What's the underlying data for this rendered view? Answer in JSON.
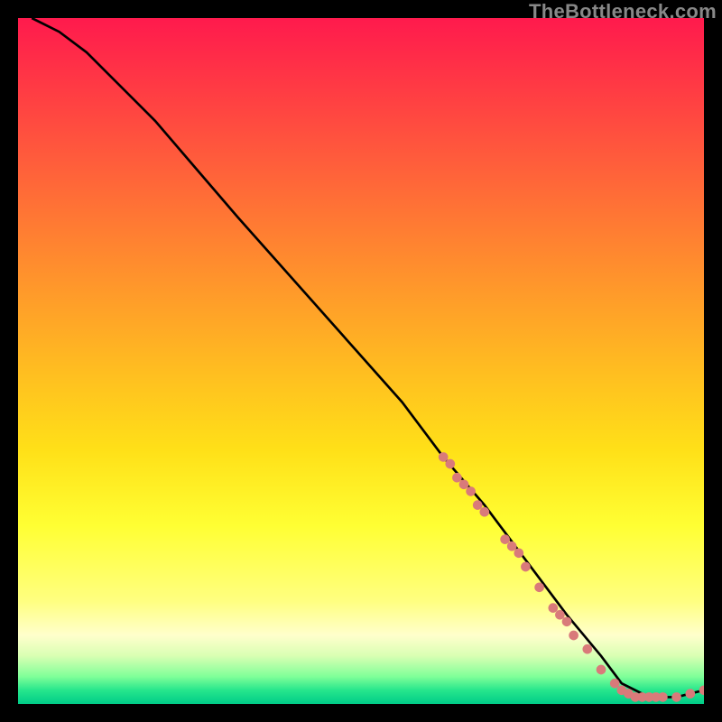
{
  "attribution": "TheBottleneck.com",
  "chart_data": {
    "type": "line",
    "title": "",
    "xlabel": "",
    "ylabel": "",
    "xlim": [
      0,
      100
    ],
    "ylim": [
      0,
      100
    ],
    "gradient_stops": [
      {
        "pct": 0,
        "color": "#ff1a4d"
      },
      {
        "pct": 10,
        "color": "#ff3a44"
      },
      {
        "pct": 20,
        "color": "#ff5a3c"
      },
      {
        "pct": 30,
        "color": "#ff7a33"
      },
      {
        "pct": 40,
        "color": "#ff9a2a"
      },
      {
        "pct": 52,
        "color": "#ffbf20"
      },
      {
        "pct": 63,
        "color": "#ffe018"
      },
      {
        "pct": 74,
        "color": "#ffff33"
      },
      {
        "pct": 85,
        "color": "#ffff80"
      },
      {
        "pct": 90,
        "color": "#ffffcc"
      },
      {
        "pct": 93,
        "color": "#d9ffb3"
      },
      {
        "pct": 96,
        "color": "#80ff99"
      },
      {
        "pct": 98,
        "color": "#26e68c"
      },
      {
        "pct": 100,
        "color": "#00cc88"
      }
    ],
    "series": [
      {
        "name": "bottleneck-curve",
        "color": "#000000",
        "x": [
          2,
          6,
          10,
          14,
          20,
          26,
          32,
          40,
          48,
          56,
          62,
          68,
          74,
          80,
          85,
          88,
          92,
          96,
          100
        ],
        "y": [
          100,
          98,
          95,
          91,
          85,
          78,
          71,
          62,
          53,
          44,
          36,
          29,
          21,
          13,
          7,
          3,
          1,
          1,
          2
        ]
      }
    ],
    "markers": {
      "name": "sample-points",
      "color": "#d97a7a",
      "radius": 5,
      "points": [
        {
          "x": 62,
          "y": 36
        },
        {
          "x": 63,
          "y": 35
        },
        {
          "x": 64,
          "y": 33
        },
        {
          "x": 65,
          "y": 32
        },
        {
          "x": 66,
          "y": 31
        },
        {
          "x": 67,
          "y": 29
        },
        {
          "x": 68,
          "y": 28
        },
        {
          "x": 71,
          "y": 24
        },
        {
          "x": 72,
          "y": 23
        },
        {
          "x": 73,
          "y": 22
        },
        {
          "x": 74,
          "y": 20
        },
        {
          "x": 76,
          "y": 17
        },
        {
          "x": 78,
          "y": 14
        },
        {
          "x": 79,
          "y": 13
        },
        {
          "x": 80,
          "y": 12
        },
        {
          "x": 81,
          "y": 10
        },
        {
          "x": 83,
          "y": 8
        },
        {
          "x": 85,
          "y": 5
        },
        {
          "x": 87,
          "y": 3
        },
        {
          "x": 88,
          "y": 2
        },
        {
          "x": 89,
          "y": 1.5
        },
        {
          "x": 90,
          "y": 1
        },
        {
          "x": 91,
          "y": 1
        },
        {
          "x": 92,
          "y": 1
        },
        {
          "x": 93,
          "y": 1
        },
        {
          "x": 94,
          "y": 1
        },
        {
          "x": 96,
          "y": 1
        },
        {
          "x": 98,
          "y": 1.5
        },
        {
          "x": 100,
          "y": 2
        }
      ]
    }
  }
}
